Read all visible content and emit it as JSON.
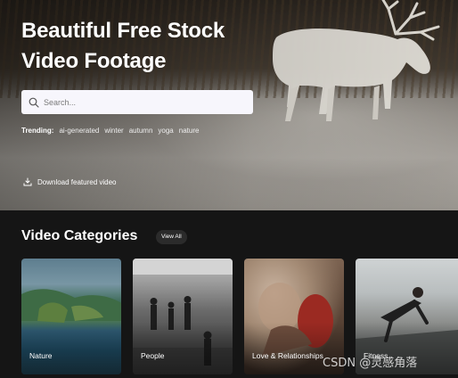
{
  "hero": {
    "title": "Beautiful Free Stock Video Footage",
    "search_placeholder": "Search...",
    "trending_label": "Trending:",
    "trending_tags": [
      "ai-generated",
      "winter",
      "autumn",
      "yoga",
      "nature"
    ],
    "download_label": "Download featured video"
  },
  "categories": {
    "title": "Video Categories",
    "view_all_label": "View All",
    "items": [
      {
        "label": "Nature"
      },
      {
        "label": "People"
      },
      {
        "label": "Love & Relationships"
      },
      {
        "label": "Fitness"
      }
    ]
  },
  "watermark": "CSDN @灵感角落",
  "icons": {
    "search": "search-icon",
    "download": "download-icon"
  },
  "colors": {
    "background": "#151515",
    "search_bg": "#f7f6fc",
    "view_all_bg": "#2b2b2b"
  }
}
